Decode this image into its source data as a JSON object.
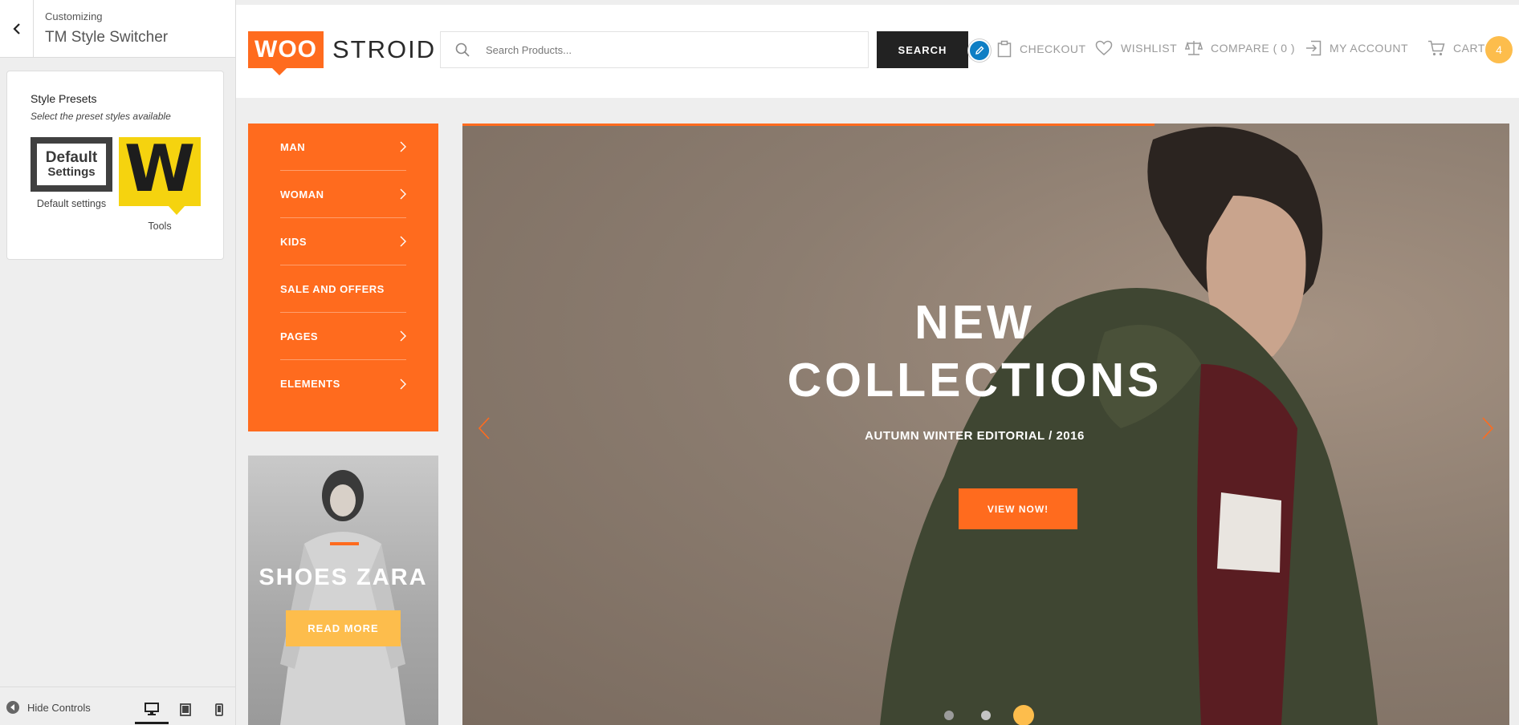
{
  "customizer": {
    "breadcrumb": "Customizing",
    "title": "TM Style Switcher",
    "presets": {
      "title": "Style Presets",
      "description": "Select the preset styles available",
      "items": [
        {
          "thumb_line1": "Default",
          "thumb_line2": "Settings",
          "label": "Default settings"
        },
        {
          "thumb_letter": "W",
          "label": "Tools"
        }
      ]
    },
    "footer": {
      "hide_controls": "Hide Controls"
    }
  },
  "site": {
    "logo_box": "WOO",
    "logo_text": "STROID",
    "search": {
      "placeholder": "Search Products...",
      "button": "SEARCH"
    },
    "nav": {
      "checkout": "CHECKOUT",
      "wishlist": "WISHLIST",
      "compare": "COMPARE ( 0 )",
      "account": "MY ACCOUNT",
      "cart": "CART",
      "cart_count": "4"
    },
    "categories": [
      {
        "label": "MAN",
        "has_arrow": true
      },
      {
        "label": "WOMAN",
        "has_arrow": true
      },
      {
        "label": "KIDS",
        "has_arrow": true
      },
      {
        "label": "SALE AND OFFERS",
        "has_arrow": false
      },
      {
        "label": "PAGES",
        "has_arrow": true
      },
      {
        "label": "ELEMENTS",
        "has_arrow": true
      }
    ],
    "promo": {
      "title": "SHOES ZARA",
      "button": "READ MORE"
    },
    "hero": {
      "title_line1": "NEW",
      "title_line2": "COLLECTIONS",
      "subtitle": "AUTUMN WINTER EDITORIAL / 2016",
      "button": "VIEW NOW!",
      "slide_count": 3,
      "active_slide": 3
    }
  },
  "colors": {
    "accent": "#ff6b1e",
    "accent_yellow": "#fdbd4c",
    "dark": "#222222",
    "edit_blue": "#0e7ec4"
  }
}
